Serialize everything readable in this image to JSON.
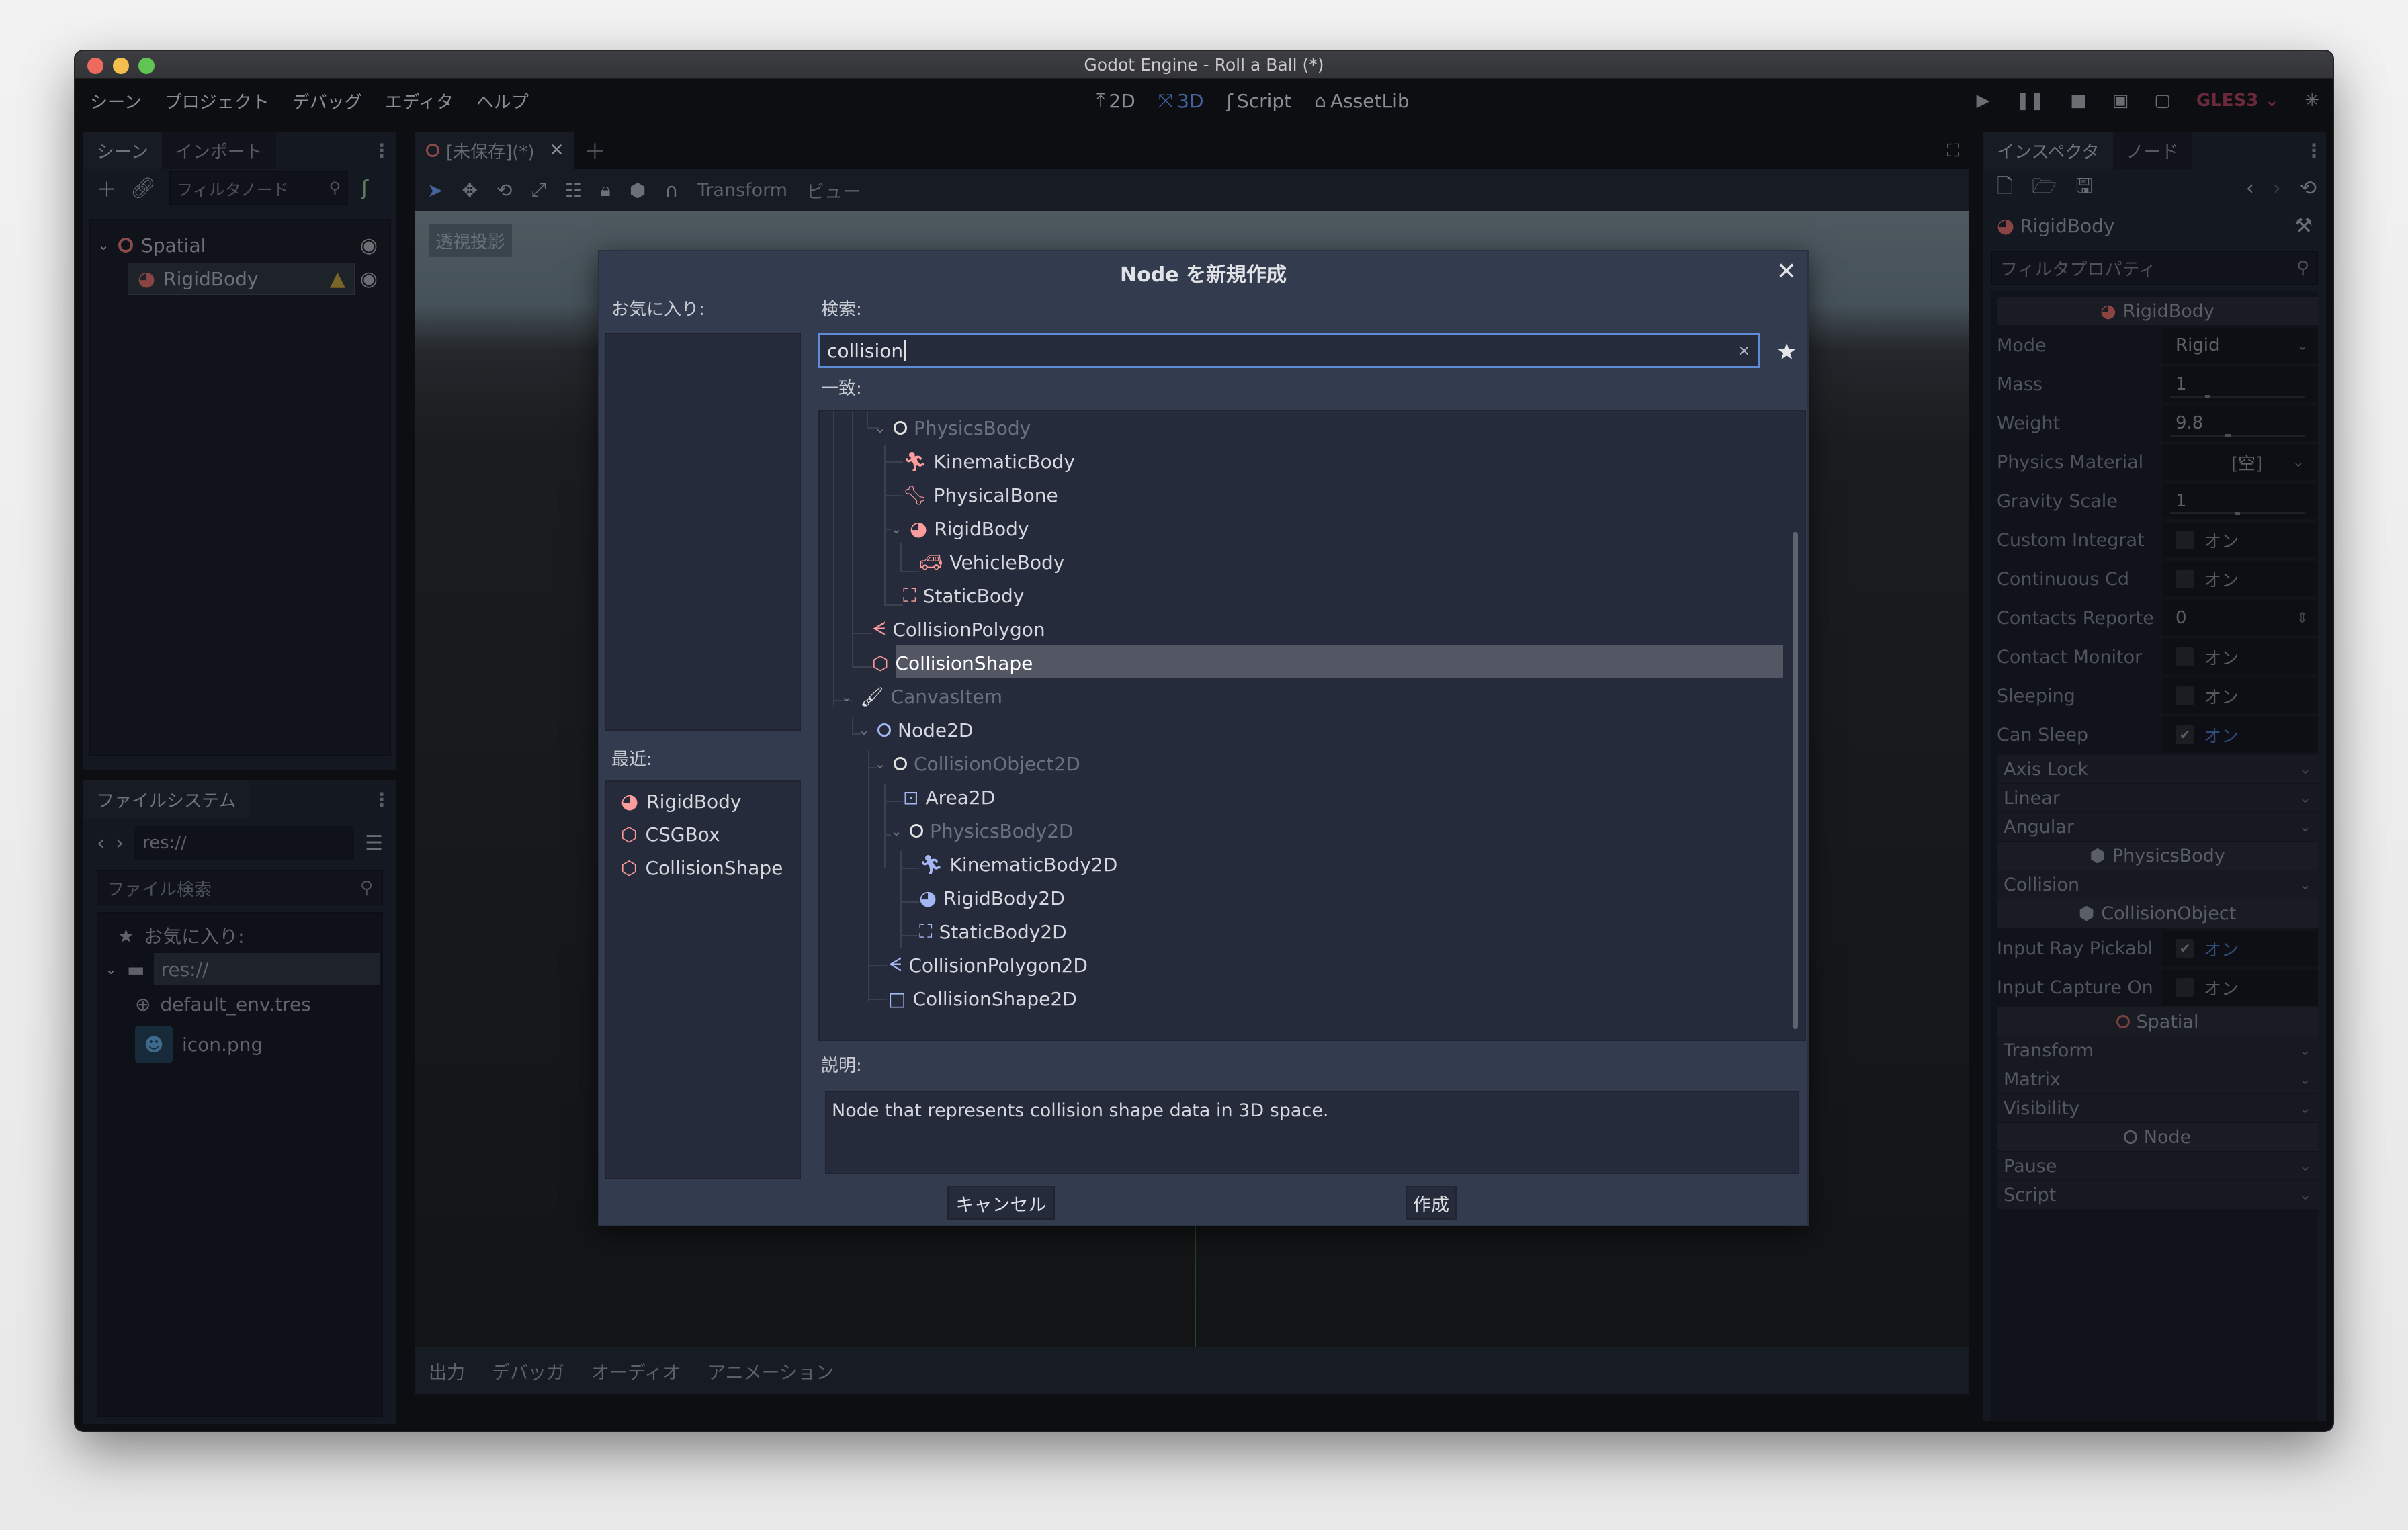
{
  "window": {
    "title": "Godot Engine - Roll a Ball (*)"
  },
  "menubar": {
    "items": [
      "シーン",
      "プロジェクト",
      "デバッグ",
      "エディタ",
      "ヘルプ"
    ],
    "workspaces": [
      {
        "label": "2D",
        "icon": "2d-icon",
        "active": false
      },
      {
        "label": "3D",
        "icon": "3d-icon",
        "active": true
      },
      {
        "label": "Script",
        "icon": "script-icon",
        "active": false
      },
      {
        "label": "AssetLib",
        "icon": "assetlib-icon",
        "active": false
      }
    ],
    "renderer": "GLES3"
  },
  "scene_dock": {
    "tabs": [
      "シーン",
      "インポート"
    ],
    "filter_placeholder": "フィルタノード",
    "tree": [
      {
        "label": "Spatial",
        "icon": "spatial-icon",
        "level": 0,
        "expanded": true
      },
      {
        "label": "RigidBody",
        "icon": "rigidbody-icon",
        "level": 1,
        "selected": true,
        "warning": true
      }
    ]
  },
  "filesystem_dock": {
    "tab": "ファイルシステム",
    "path": "res://",
    "search_placeholder": "ファイル検索",
    "favorites_label": "お気に入り:",
    "tree": [
      {
        "label": "res://",
        "icon": "folder-icon",
        "selected": true
      },
      {
        "label": "default_env.tres",
        "icon": "environment-icon"
      },
      {
        "label": "icon.png",
        "icon": "godot-logo-icon"
      }
    ]
  },
  "editor": {
    "scene_tab": "[未保存](*)",
    "toolbar_menus": [
      "Transform",
      "ビュー"
    ],
    "viewport_label": "透視投影",
    "bottom_tabs": [
      "出力",
      "デバッガ",
      "オーディオ",
      "アニメーション"
    ]
  },
  "inspector": {
    "tabs": [
      "インスペクタ",
      "ノード"
    ],
    "node_name": "RigidBody",
    "filter_placeholder": "フィルタプロパティ",
    "sections": {
      "rigidbody": "RigidBody",
      "physicsbody": "PhysicsBody",
      "collisionobject": "CollisionObject",
      "spatial": "Spatial",
      "node": "Node"
    },
    "props": {
      "mode": {
        "label": "Mode",
        "value": "Rigid"
      },
      "mass": {
        "label": "Mass",
        "value": "1"
      },
      "weight": {
        "label": "Weight",
        "value": "9.8"
      },
      "physics_material": {
        "label": "Physics Material",
        "value": "[空]"
      },
      "gravity_scale": {
        "label": "Gravity Scale",
        "value": "1"
      },
      "custom_integrator": {
        "label": "Custom Integrat",
        "value": "オン",
        "checked": false
      },
      "continuous_cd": {
        "label": "Continuous Cd",
        "value": "オン",
        "checked": false
      },
      "contacts_reported": {
        "label": "Contacts Reporte",
        "value": "0"
      },
      "contact_monitor": {
        "label": "Contact Monitor",
        "value": "オン",
        "checked": false
      },
      "sleeping": {
        "label": "Sleeping",
        "value": "オン",
        "checked": false
      },
      "can_sleep": {
        "label": "Can Sleep",
        "value": "オン",
        "checked": true
      },
      "input_ray_pickable": {
        "label": "Input Ray Pickabl",
        "value": "オン",
        "checked": true
      },
      "input_capture_on_drag": {
        "label": "Input Capture On",
        "value": "オン",
        "checked": false
      }
    },
    "groups": {
      "axis_lock": "Axis Lock",
      "linear": "Linear",
      "angular": "Angular",
      "collision": "Collision",
      "transform": "Transform",
      "matrix": "Matrix",
      "visibility": "Visibility",
      "pause": "Pause",
      "script": "Script"
    }
  },
  "dialog": {
    "title": "Node を新規作成",
    "favorites_label": "お気に入り:",
    "recent_label": "最近:",
    "search_label": "検索:",
    "search_value": "collision",
    "matches_label": "一致:",
    "description_label": "説明:",
    "description": "Node that represents collision shape data in 3D space.",
    "cancel": "キャンセル",
    "create": "作成",
    "recent": [
      {
        "label": "RigidBody",
        "icon": "rigidbody-icon"
      },
      {
        "label": "CSGBox",
        "icon": "csgbox-icon"
      },
      {
        "label": "CollisionShape",
        "icon": "collisionshape-icon"
      }
    ],
    "matches": [
      {
        "label": "PhysicsBody",
        "icon": "physicsbody-icon",
        "dim": true,
        "level": 3,
        "expanded": true
      },
      {
        "label": "KinematicBody",
        "icon": "kinematicbody-icon",
        "level": 4
      },
      {
        "label": "PhysicalBone",
        "icon": "physicalbone-icon",
        "level": 4
      },
      {
        "label": "RigidBody",
        "icon": "rigidbody-icon",
        "level": 4,
        "expanded": true
      },
      {
        "label": "VehicleBody",
        "icon": "vehiclebody-icon",
        "level": 5
      },
      {
        "label": "StaticBody",
        "icon": "staticbody-icon",
        "level": 4
      },
      {
        "label": "CollisionPolygon",
        "icon": "collisionpolygon-icon",
        "level": 2
      },
      {
        "label": "CollisionShape",
        "icon": "collisionshape-icon",
        "level": 2,
        "selected": true
      },
      {
        "label": "CanvasItem",
        "icon": "canvasitem-icon",
        "dim": true,
        "level": 1,
        "expanded": true
      },
      {
        "label": "Node2D",
        "icon": "node2d-icon",
        "level": 2,
        "expanded": true
      },
      {
        "label": "CollisionObject2D",
        "icon": "collisionobject2d-icon",
        "dim": true,
        "level": 3,
        "expanded": true
      },
      {
        "label": "Area2D",
        "icon": "area2d-icon",
        "level": 4
      },
      {
        "label": "PhysicsBody2D",
        "icon": "physicsbody2d-icon",
        "dim": true,
        "level": 4,
        "expanded": true
      },
      {
        "label": "KinematicBody2D",
        "icon": "kinematicbody2d-icon",
        "level": 5
      },
      {
        "label": "RigidBody2D",
        "icon": "rigidbody2d-icon",
        "level": 5
      },
      {
        "label": "StaticBody2D",
        "icon": "staticbody2d-icon",
        "level": 5
      },
      {
        "label": "CollisionPolygon2D",
        "icon": "collisionpolygon2d-icon",
        "level": 3
      },
      {
        "label": "CollisionShape2D",
        "icon": "collisionshape2d-icon",
        "level": 3
      }
    ]
  },
  "colors": {
    "accent": "#5f8bd6",
    "node3d": "#fc9c9c",
    "node2d": "#a5b7f3",
    "dialog_bg": "#333b4f",
    "selection": "#525763"
  }
}
